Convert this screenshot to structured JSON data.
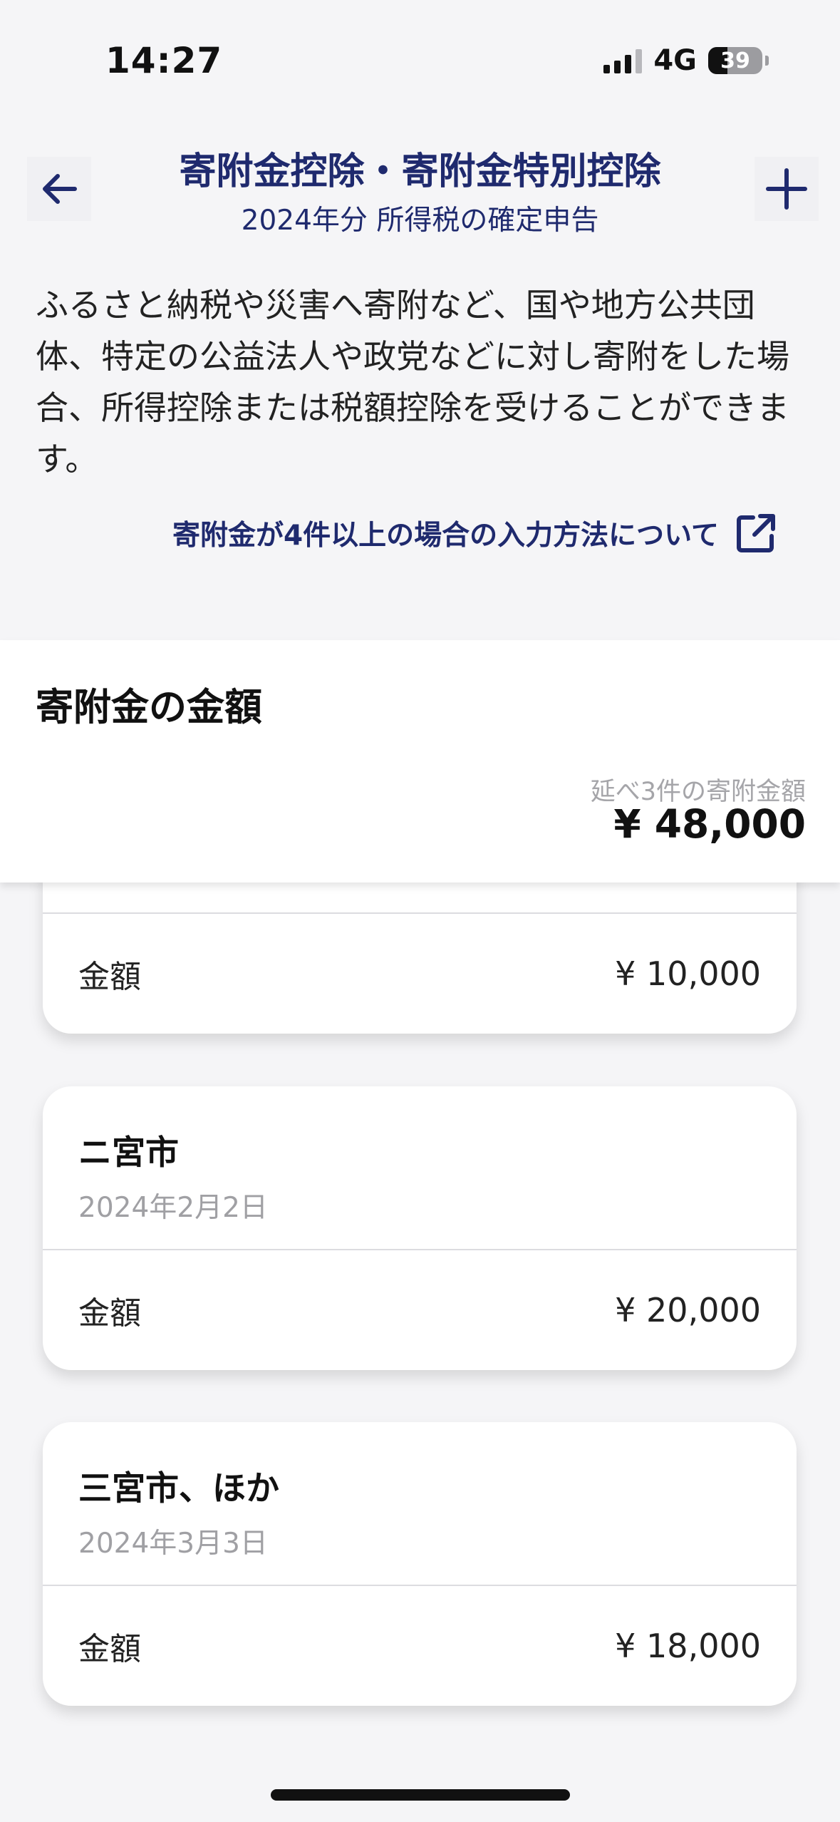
{
  "status_bar": {
    "time": "14:27",
    "network": "4G",
    "battery": "39"
  },
  "nav": {
    "title": "寄附金控除・寄附金特別控除",
    "subtitle": "2024年分 所得税の確定申告",
    "back_icon": "arrow-left-icon",
    "add_icon": "plus-icon"
  },
  "description": "ふるさと納税や災害へ寄附など、国や地方公共団体、特定の公益法人や政党などに対し寄附をした場合、所得控除または税額控除を受けることができます。",
  "help_link": {
    "label": "寄附金が4件以上の場合の入力方法について",
    "icon": "external-link-icon"
  },
  "summary": {
    "title": "寄附金の金額",
    "caption": "延べ3件の寄附金額",
    "total": "¥ 48,000"
  },
  "donations": [
    {
      "amount_label": "金額",
      "amount": "¥ 10,000"
    },
    {
      "name": "ニ宮市",
      "date": "2024年2月2日",
      "amount_label": "金額",
      "amount": "¥ 20,000"
    },
    {
      "name": "三宮市、ほか",
      "date": "2024年3月3日",
      "amount_label": "金額",
      "amount": "¥ 18,000"
    }
  ],
  "colors": {
    "accent": "#1f2a6e",
    "background": "#f5f5f7",
    "muted": "#a0a0a4"
  }
}
